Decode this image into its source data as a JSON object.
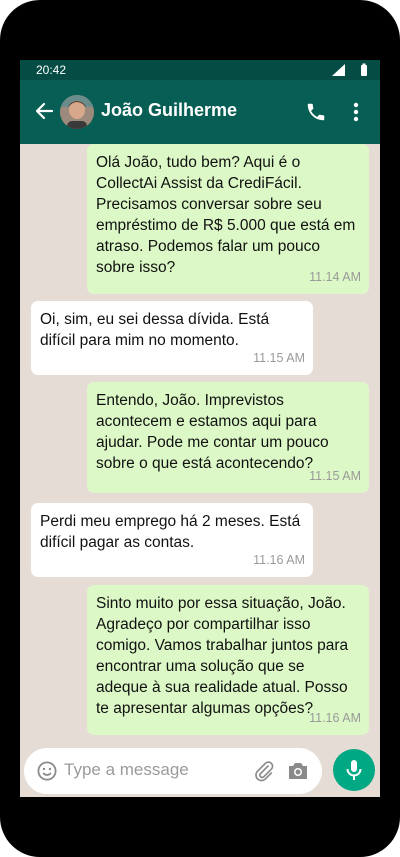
{
  "status_bar": {
    "time": "20:42"
  },
  "header": {
    "contact_name": "João Guilherme"
  },
  "messages": [
    {
      "direction": "out",
      "text": "Olá João, tudo bem? Aqui é o CollectAi Assist da CrediFácil. Precisamos conversar sobre seu empréstimo de R$ 5.000 que está em atraso. Podemos falar um pouco sobre isso?",
      "time": "11.14 AM"
    },
    {
      "direction": "in",
      "text": "Oi, sim, eu sei dessa dívida. Está difícil para mim no momento.",
      "time": "11.15 AM"
    },
    {
      "direction": "out",
      "text": "Entendo, João. Imprevistos acontecem e estamos aqui para ajudar. Pode me contar um pouco sobre o que está acontecendo?",
      "time": "11.15 AM"
    },
    {
      "direction": "in",
      "text": "Perdi meu emprego há 2 meses. Está difícil pagar as contas.",
      "time": "11.16 AM"
    },
    {
      "direction": "out",
      "text": "Sinto muito por essa situação, João. Agradeço por compartilhar isso comigo. Vamos trabalhar juntos para encontrar uma solução que se adeque à sua realidade atual. Posso te apresentar algumas opções?",
      "time": "11.16 AM"
    }
  ],
  "composer": {
    "placeholder": "Type a message",
    "value": ""
  },
  "colors": {
    "header": "#075e54",
    "status_bar": "#054d44",
    "outgoing": "#dcf8c6",
    "incoming": "#ffffff",
    "background": "#e5ddd5",
    "mic": "#00a884"
  }
}
